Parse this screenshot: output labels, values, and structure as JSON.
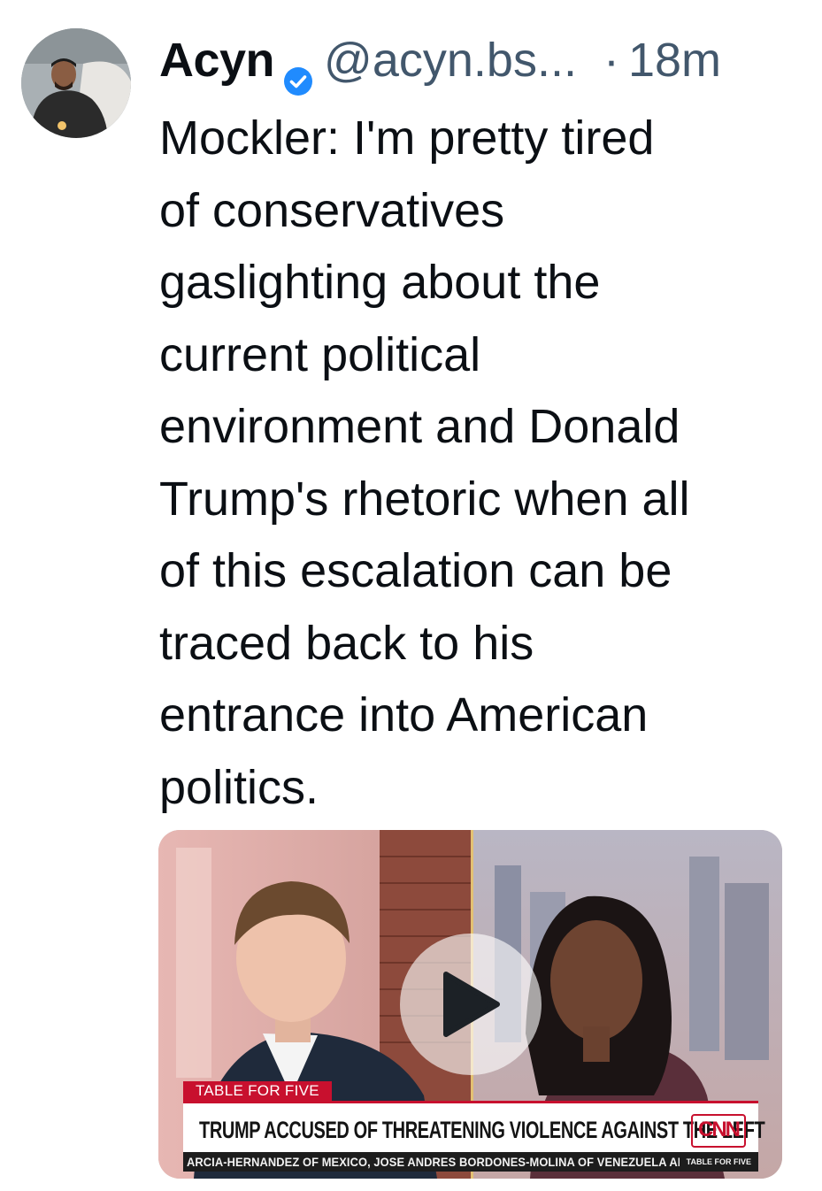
{
  "post": {
    "author": {
      "display_name": "Acyn",
      "handle": "@acyn.bs...",
      "verified_icon": "verified-badge-icon"
    },
    "separator": "·",
    "timestamp": "18m",
    "text": "Mockler: I'm pretty tired\nof conservatives\ngaslighting about the\ncurrent political\nenvironment and Donald\nTrump's rhetoric when all\nof this escalation can be\ntraced back to his\nentrance into American\npolitics.",
    "video": {
      "segment_tag": "TABLE FOR FIVE",
      "headline": "TRUMP ACCUSED OF THREATENING VIOLENCE AGAINST THE LEFT",
      "network_logo": "CNN",
      "ticker": "ARCIA-HERNANDEZ OF MEXICO, JOSE ANDRES BORDONES-MOLINA OF VENEZUELA AI",
      "ticker_tag": "TABLE FOR FIVE",
      "play_icon": "play-icon"
    }
  },
  "colors": {
    "verified": "#208bfe",
    "meta_text": "#42576c",
    "cnn_red": "#c8102e"
  }
}
